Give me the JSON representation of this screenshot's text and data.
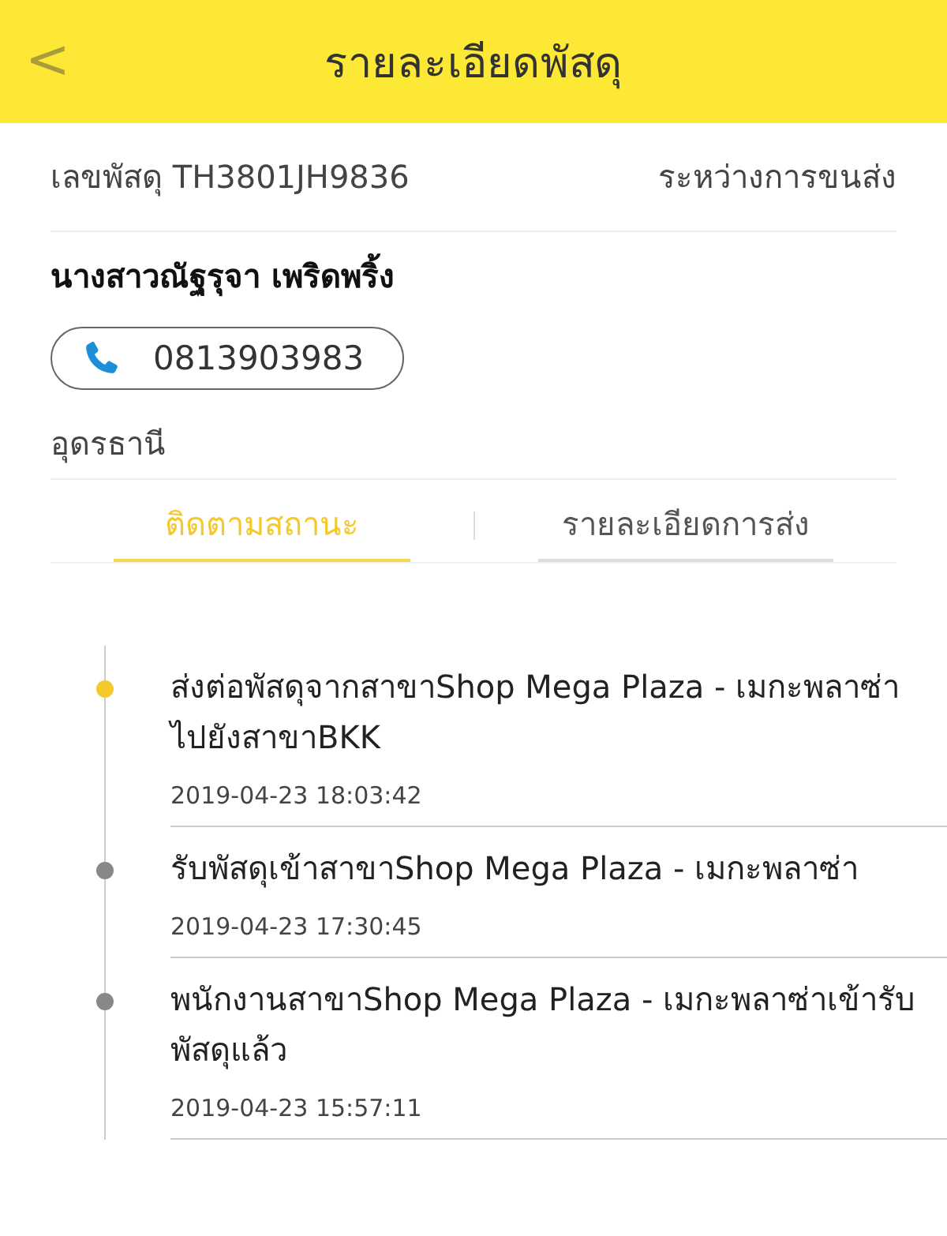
{
  "header": {
    "back": "<",
    "title": "รายละเอียดพัสดุ"
  },
  "parcel": {
    "tracking": "เลขพัสดุ TH3801JH9836",
    "status": "ระหว่างการขนส่ง",
    "recipient": "นางสาวณัฐรุจา เพริดพริ้ง",
    "phone": "0813903983",
    "province": "อุดรธานี"
  },
  "tabs": [
    {
      "label": "ติดตามสถานะ",
      "selected": true
    },
    {
      "label": "รายละเอียดการส่ง",
      "selected": false
    }
  ],
  "timeline": [
    {
      "text": "ส่งต่อพัสดุจากสาขาShop Mega Plaza - เมกะพลาซ่า ไปยังสาขาBKK",
      "time": "2019-04-23 18:03:42",
      "current": true
    },
    {
      "text": "รับพัสดุเข้าสาขาShop Mega Plaza - เมกะพลาซ่า",
      "time": "2019-04-23 17:30:45",
      "current": false
    },
    {
      "text": "พนักงานสาขาShop Mega Plaza - เมกะพลาซ่าเข้ารับพัสดุแล้ว",
      "time": "2019-04-23 15:57:11",
      "current": false
    }
  ]
}
